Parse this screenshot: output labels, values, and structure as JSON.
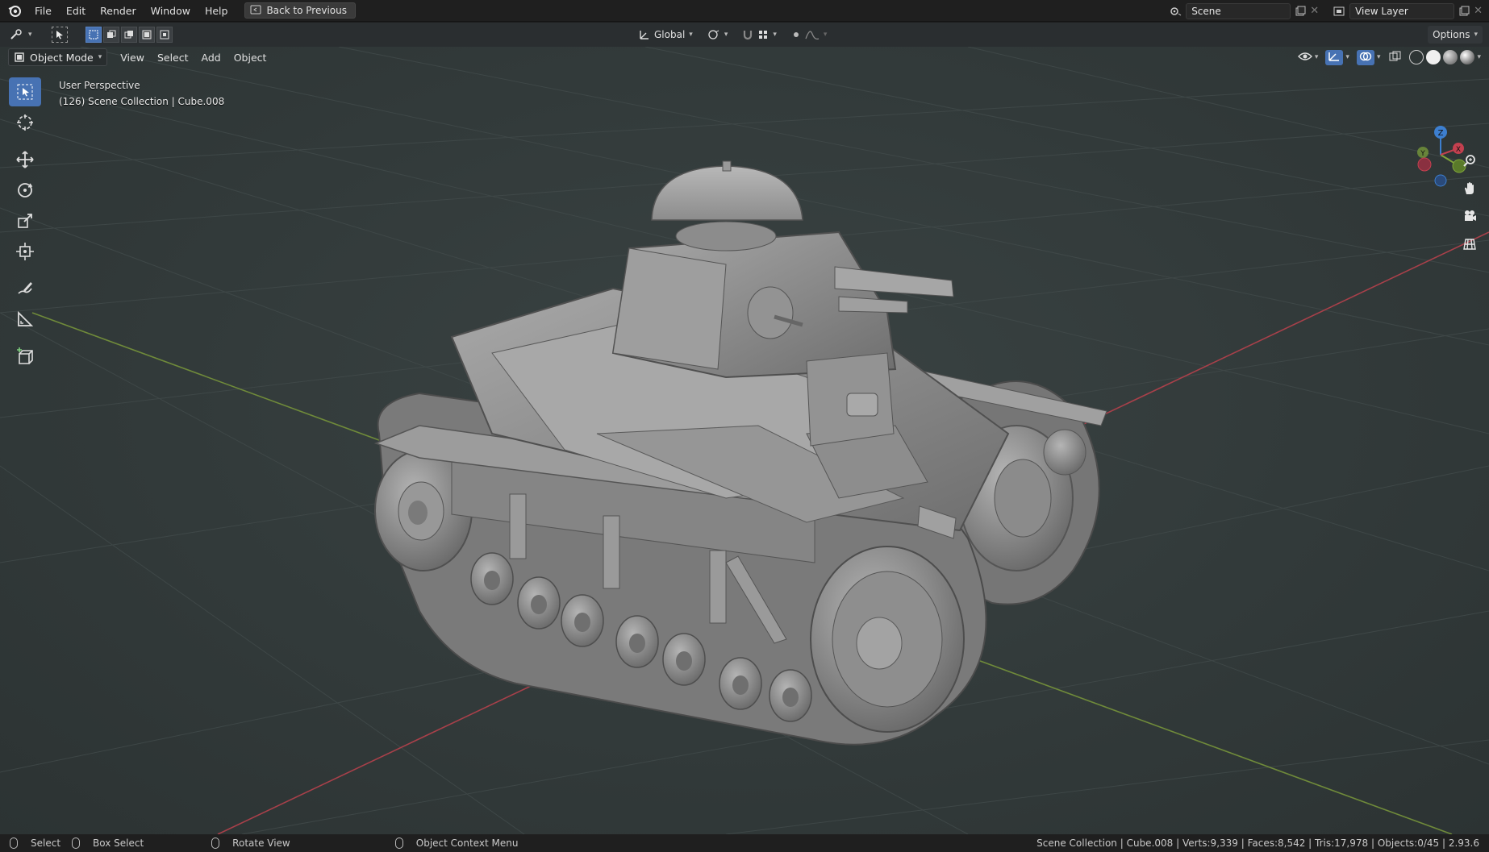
{
  "topbar": {
    "menus": [
      "File",
      "Edit",
      "Render",
      "Window",
      "Help"
    ],
    "back_button": "Back to Previous",
    "scene_name": "Scene",
    "view_layer": "View Layer"
  },
  "toolheader": {
    "orientation": "Global",
    "options": "Options"
  },
  "viewport_header": {
    "mode": "Object Mode",
    "menus": [
      "View",
      "Select",
      "Add",
      "Object"
    ]
  },
  "viewport": {
    "perspective": "User Perspective",
    "collection_info": "(126) Scene Collection | Cube.008",
    "gizmo_axes": [
      "Z",
      "Y",
      "X"
    ]
  },
  "statusbar": {
    "select": "Select",
    "box_select": "Box Select",
    "rotate_view": "Rotate View",
    "context_menu": "Object Context Menu",
    "stats": "Scene Collection | Cube.008 | Verts:9,339 | Faces:8,542 | Tris:17,978 | Objects:0/45 | 2.93.6"
  },
  "colors": {
    "accent": "#4772b3",
    "axis_x": "#c3404f",
    "axis_y": "#7fa43a",
    "axis_z": "#3d7fd0",
    "model_gray": "#8a8a8a"
  },
  "icons": [
    "blender-logo-icon",
    "back-icon",
    "scene-icon",
    "view-layer-icon",
    "select-box-icon",
    "cursor-icon",
    "move-icon",
    "rotate-icon",
    "scale-icon",
    "transform-icon",
    "annotate-icon",
    "measure-icon",
    "add-cube-icon",
    "zoom-icon",
    "pan-hand-icon",
    "camera-icon",
    "grid-ortho-icon"
  ]
}
